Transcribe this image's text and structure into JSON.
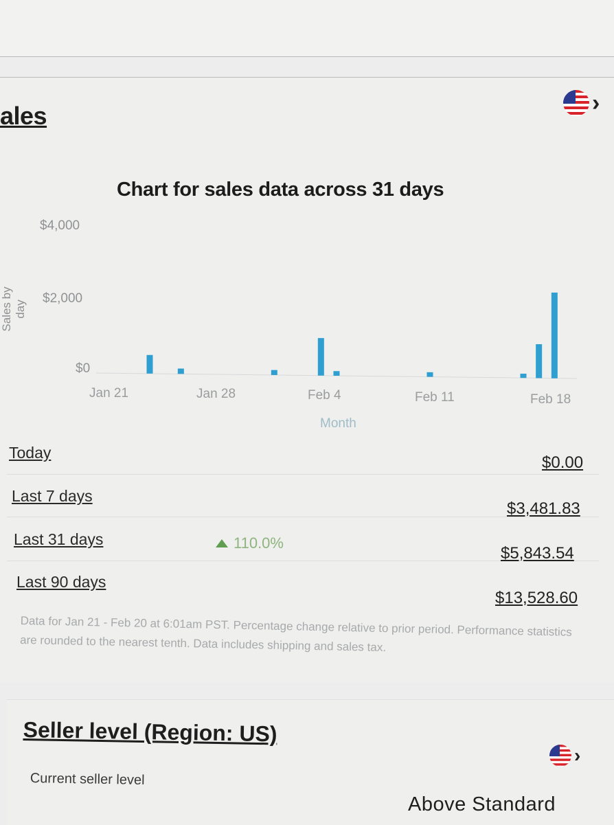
{
  "sales": {
    "title": "ales"
  },
  "chart": {
    "heading": "Chart for sales data across 31 days",
    "ylabel": "Sales by day",
    "xlabel": "Month",
    "yticks": [
      "$4,000",
      "$2,000",
      "$0"
    ],
    "xticks": [
      "Jan 21",
      "Jan 28",
      "Feb 4",
      "Feb 11",
      "Feb 18"
    ],
    "bar_color": "#2e9fd0"
  },
  "chart_data": {
    "type": "bar",
    "title": "Chart for sales data across 31 days",
    "xlabel": "Month",
    "ylabel": "Sales by day",
    "ylim": [
      0,
      4000
    ],
    "grid": false,
    "categories": [
      "Jan 21",
      "Jan 22",
      "Jan 23",
      "Jan 24",
      "Jan 25",
      "Jan 26",
      "Jan 27",
      "Jan 28",
      "Jan 29",
      "Jan 30",
      "Jan 31",
      "Feb 1",
      "Feb 2",
      "Feb 3",
      "Feb 4",
      "Feb 5",
      "Feb 6",
      "Feb 7",
      "Feb 8",
      "Feb 9",
      "Feb 10",
      "Feb 11",
      "Feb 12",
      "Feb 13",
      "Feb 14",
      "Feb 15",
      "Feb 16",
      "Feb 17",
      "Feb 18",
      "Feb 19",
      "Feb 20"
    ],
    "values": [
      0,
      0,
      0,
      520,
      0,
      150,
      0,
      0,
      0,
      0,
      0,
      140,
      0,
      0,
      1050,
      130,
      0,
      0,
      0,
      0,
      0,
      130,
      0,
      0,
      0,
      0,
      0,
      120,
      950,
      2400,
      0
    ]
  },
  "stats": [
    {
      "label": "Today",
      "value": "$0.00"
    },
    {
      "label": "Last 7 days",
      "value": "$3,481.83"
    },
    {
      "label": "Last 31 days",
      "value": "$5,843.54",
      "change": "110.0%"
    },
    {
      "label": "Last 90 days",
      "value": "$13,528.60"
    }
  ],
  "footnote": "Data for Jan 21 - Feb 20 at 6:01am PST. Percentage change relative to prior period. Performance statistics are rounded to the nearest tenth. Data includes shipping and sales tax.",
  "seller_level": {
    "title": "Seller level (Region: US)",
    "current_label": "Current seller level",
    "current_value": "Above Standard"
  },
  "icons": {
    "flag": "us-flag-icon",
    "chevron": "chevron-right-icon"
  },
  "colors": {
    "accent_green": "#5f9e4e",
    "bar_blue": "#2e9fd0"
  }
}
